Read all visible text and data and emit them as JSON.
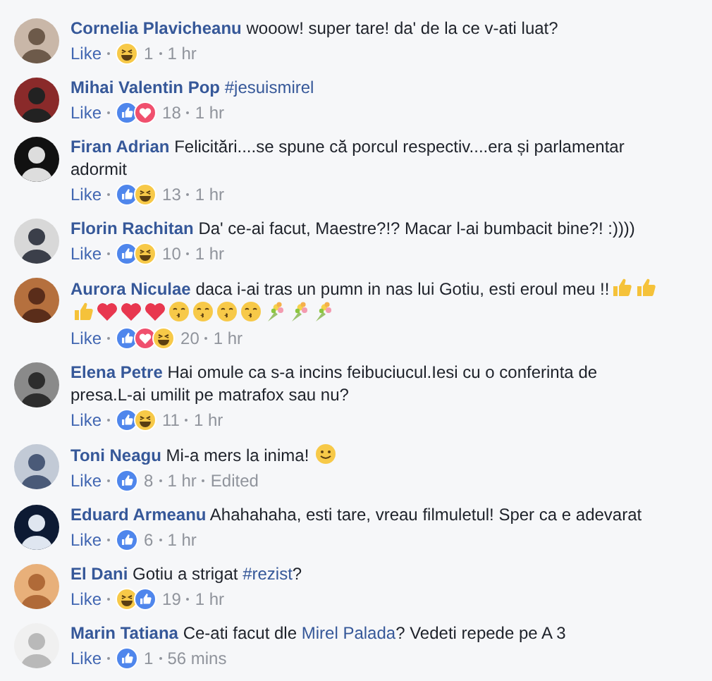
{
  "comments": [
    {
      "author": "Cornelia Plavicheanu",
      "message": [
        {
          "kind": "text",
          "text": "wooow! super tare! da' de la ce v-ati luat?"
        }
      ],
      "like_label": "Like",
      "reactions": [
        {
          "kind": "haha"
        }
      ],
      "count": "1",
      "time": "1 hr"
    },
    {
      "author": "Mihai Valentin Pop",
      "message": [
        {
          "kind": "link",
          "text": "#jesuismirel"
        }
      ],
      "like_label": "Like",
      "reactions": [
        {
          "kind": "like"
        },
        {
          "kind": "love"
        }
      ],
      "count": "18",
      "time": "1 hr"
    },
    {
      "author": "Firan Adrian",
      "message": [
        {
          "kind": "text",
          "text": "Felicitări....se spune că porcul respectiv....era și parlamentar adormit"
        }
      ],
      "like_label": "Like",
      "reactions": [
        {
          "kind": "like"
        },
        {
          "kind": "haha"
        }
      ],
      "count": "13",
      "time": "1 hr"
    },
    {
      "author": "Florin Rachitan",
      "message": [
        {
          "kind": "text",
          "text": "Da' ce-ai facut, Maestre?!? Macar l-ai bumbacit bine?! :))))"
        }
      ],
      "like_label": "Like",
      "reactions": [
        {
          "kind": "like"
        },
        {
          "kind": "haha"
        }
      ],
      "count": "10",
      "time": "1 hr"
    },
    {
      "author": "Aurora Niculae",
      "message": [
        {
          "kind": "text",
          "text": "daca i-ai tras un pumn in nas lui Gotiu, esti eroul meu !!"
        },
        {
          "kind": "thumbs"
        },
        {
          "kind": "thumbs"
        },
        {
          "kind": "thumbs"
        },
        {
          "kind": "heart"
        },
        {
          "kind": "heart"
        },
        {
          "kind": "heart"
        },
        {
          "kind": "kiss"
        },
        {
          "kind": "kiss"
        },
        {
          "kind": "kiss"
        },
        {
          "kind": "kiss"
        },
        {
          "kind": "bouquet"
        },
        {
          "kind": "bouquet"
        },
        {
          "kind": "bouquet"
        }
      ],
      "like_label": "Like",
      "reactions": [
        {
          "kind": "like"
        },
        {
          "kind": "love"
        },
        {
          "kind": "haha"
        }
      ],
      "count": "20",
      "time": "1 hr"
    },
    {
      "author": "Elena Petre",
      "message": [
        {
          "kind": "text",
          "text": "Hai omule ca s-a incins feibuciucul.Iesi cu o conferinta de presa.L-ai umilit pe matrafox sau nu?"
        }
      ],
      "like_label": "Like",
      "reactions": [
        {
          "kind": "like"
        },
        {
          "kind": "haha"
        }
      ],
      "count": "11",
      "time": "1 hr"
    },
    {
      "author": "Toni Neagu",
      "message": [
        {
          "kind": "text",
          "text": "Mi-a mers la inima!"
        },
        {
          "kind": "smile"
        }
      ],
      "like_label": "Like",
      "reactions": [
        {
          "kind": "like"
        }
      ],
      "count": "8",
      "time": "1 hr",
      "edited": "Edited"
    },
    {
      "author": "Eduard Armeanu",
      "message": [
        {
          "kind": "text",
          "text": "Ahahahaha, esti tare, vreau filmuletul! Sper ca e adevarat"
        }
      ],
      "like_label": "Like",
      "reactions": [
        {
          "kind": "like"
        }
      ],
      "count": "6",
      "time": "1 hr"
    },
    {
      "author": "El Dani",
      "message": [
        {
          "kind": "text",
          "text": "Gotiu a strigat"
        },
        {
          "kind": "link",
          "text": "#rezist"
        },
        {
          "kind": "text",
          "text": "?",
          "joined": true
        }
      ],
      "like_label": "Like",
      "reactions": [
        {
          "kind": "haha"
        },
        {
          "kind": "like"
        }
      ],
      "count": "19",
      "time": "1 hr"
    },
    {
      "author": "Marin Tatiana",
      "message": [
        {
          "kind": "text",
          "text": "Ce-ati facut dle"
        },
        {
          "kind": "link",
          "text": "Mirel Palada"
        },
        {
          "kind": "text",
          "text": "? Vedeti repede pe A 3",
          "joined": true
        }
      ],
      "like_label": "Like",
      "reactions": [
        {
          "kind": "like"
        }
      ],
      "count": "1",
      "time": "56 mins"
    }
  ]
}
